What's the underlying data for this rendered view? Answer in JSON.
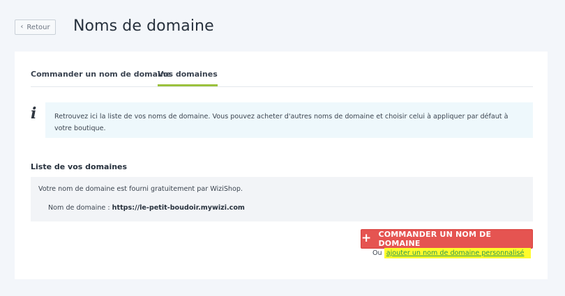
{
  "header": {
    "back_label": "Retour",
    "title": "Noms de domaine"
  },
  "tabs": [
    {
      "label": "Commander un nom de domaine",
      "active": false
    },
    {
      "label": "Vos domaines",
      "active": true
    }
  ],
  "info": {
    "icon": "info-icon",
    "text": "Retrouvez ici la liste de vos noms de domaine. Vous pouvez acheter d'autres noms de domaine et choisir celui à appliquer par défaut à votre boutique."
  },
  "domains": {
    "section_title": "Liste de vos domaines",
    "note": "Votre nom de domaine est fourni gratuitement par WiziShop.",
    "domain_label": "Nom de domaine :",
    "domain_value": "https://le-petit-boudoir.mywizi.com"
  },
  "actions": {
    "order_button": "COMMANDER UN NOM DE DOMAINE",
    "or_text": "Ou",
    "custom_link": "ajouter un nom de domaine personnalisé"
  },
  "colors": {
    "accent_tab": "#9bc13c",
    "order_button": "#e55451",
    "info_bg": "#eef8fc",
    "highlight": "#fffb2b",
    "link": "#2c9a4e"
  }
}
